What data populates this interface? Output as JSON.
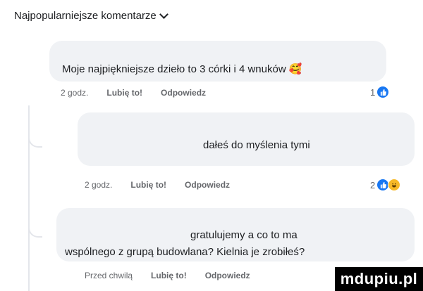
{
  "header": {
    "title": "Najpopularniejsze komentarze"
  },
  "comments": [
    {
      "text": "Moje najpiękniejsze dzieło to 3 córki i 4 wnuków",
      "emoji": "🥰",
      "time": "2 godz.",
      "like_label": "Lubię to!",
      "reply_label": "Odpowiedz",
      "reaction_count": "1"
    },
    {
      "text": "dałeś do myślenia tymi",
      "time": "2 godz.",
      "like_label": "Lubię to!",
      "reply_label": "Odpowiedz",
      "reaction_count": "2"
    },
    {
      "text_line1": "gratulujemy a co to ma",
      "text_line2": "wspólnego z grupą budowlana? Kielnia je zrobiłeś?",
      "time": "Przed chwilą",
      "like_label": "Lubię to!",
      "reply_label": "Odpowiedz"
    }
  ],
  "watermark": "mdupiu.pl"
}
